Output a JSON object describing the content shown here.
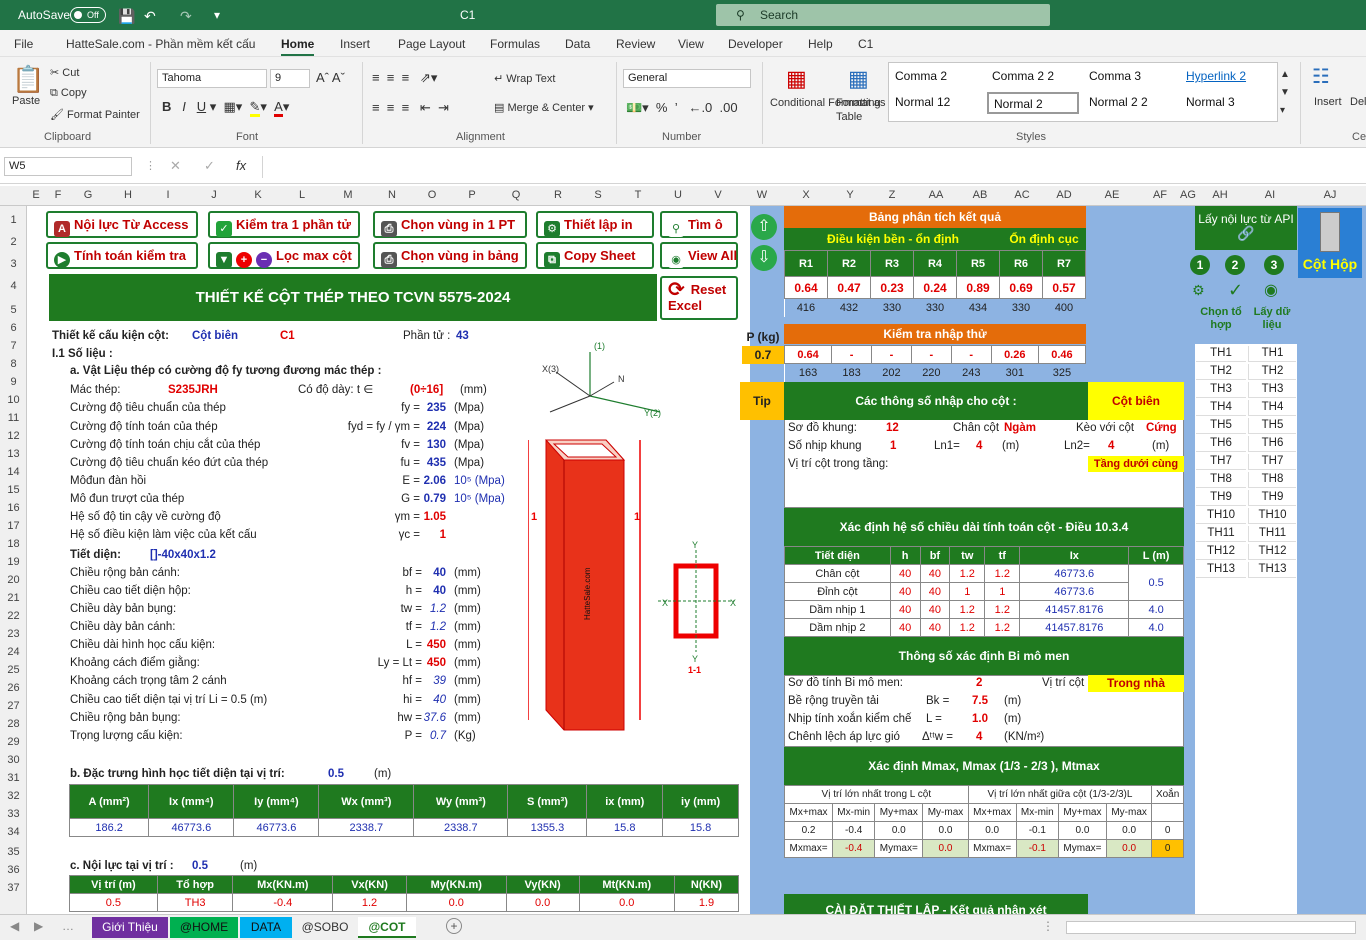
{
  "titlebar": {
    "autosave": "AutoSave",
    "autosave_state": "Off",
    "doc": "C1",
    "search": "Search"
  },
  "menu": [
    "File",
    "HatteSale.com - Phần mềm kết cấu",
    "Home",
    "Insert",
    "Page Layout",
    "Formulas",
    "Data",
    "Review",
    "View",
    "Developer",
    "Help",
    "C1"
  ],
  "ribbon": {
    "clipboard": {
      "paste": "Paste",
      "cut": "Cut",
      "copy": "Copy",
      "format_painter": "Format Painter",
      "group": "Clipboard"
    },
    "font": {
      "name": "Tahoma",
      "size": "9",
      "group": "Font"
    },
    "alignment": {
      "wrap": "Wrap Text",
      "merge": "Merge & Center",
      "group": "Alignment"
    },
    "number": {
      "format": "General",
      "group": "Number"
    },
    "styles": {
      "conditional": "Conditional Formatting",
      "format_table": "Format as Table",
      "items": [
        "Comma 2",
        "Comma 2 2",
        "Comma 3",
        "Hyperlink 2",
        "Normal 12",
        "Normal 2",
        "Normal 2 2",
        "Normal 3"
      ],
      "group": "Styles"
    },
    "cells": {
      "insert": "Insert",
      "delete": "Del",
      "group": "Ce"
    }
  },
  "formulabar": {
    "namebox": "W5",
    "fx": "fx"
  },
  "columns": [
    "E",
    "F",
    "G",
    "H",
    "I",
    "J",
    "K",
    "L",
    "M",
    "N",
    "O",
    "P",
    "Q",
    "R",
    "S",
    "T",
    "U",
    "V",
    "W",
    "X",
    "Y",
    "Z",
    "AA",
    "AB",
    "AC",
    "AD",
    "AE",
    "AF",
    "AG",
    "AH",
    "AI",
    "AJ"
  ],
  "rows": [
    "1",
    "2",
    "3",
    "4",
    "5",
    "6",
    "7",
    "8",
    "9",
    "10",
    "11",
    "12",
    "13",
    "14",
    "15",
    "16",
    "17",
    "18",
    "19",
    "20",
    "21",
    "22",
    "23",
    "24",
    "25",
    "26",
    "27",
    "28",
    "29",
    "30",
    "31",
    "32",
    "33",
    "34",
    "35",
    "36",
    "37"
  ],
  "buttons": {
    "noiluc": "Nội lực Từ Access",
    "kiemtra1": "Kiểm tra 1 phần tử",
    "chonvung1pt": "Chọn vùng in 1 PT",
    "thietlapin": "Thiết lập in",
    "timo": "Tìm ô",
    "tinhtoan": "Tính toán kiểm tra",
    "locmax": "Lọc max cột",
    "chonvungbang": "Chọn vùng in bảng",
    "copysheet": "Copy Sheet",
    "viewall": "View All",
    "reset": "Reset Excel"
  },
  "main": {
    "title": "THIẾT KẾ CỘT THÉP THEO TCVN 5575-2024",
    "design_label": "Thiết kế cấu kiện cột:",
    "design_val": "Cột biên",
    "design_id": "C1",
    "element_label": "Phần tử :",
    "element_no": "43",
    "s11": "I.1  Số liệu :",
    "s_a": "a. Vật Liệu thép có cường độ fy tương đương mác thép :",
    "props": [
      {
        "lbl": "Mác thép:",
        "sym": "",
        "val": "S235JRH",
        "unit": ""
      },
      {
        "lbl": "Cường độ tiêu chuẩn của thép",
        "sym": "fy =",
        "val": "235",
        "unit": "(Mpa)"
      },
      {
        "lbl": "Cường độ tính toán của thép",
        "sym": "fyd = fy / γm =",
        "val": "224",
        "unit": "(Mpa)"
      },
      {
        "lbl": "Cường độ tính toán chịu cắt của thép",
        "sym": "fv =",
        "val": "130",
        "unit": "(Mpa)"
      },
      {
        "lbl": "Cường độ tiêu chuẩn kéo đứt của thép",
        "sym": "fu =",
        "val": "435",
        "unit": "(Mpa)"
      },
      {
        "lbl": "Môđun đàn hồi",
        "sym": "E =",
        "val": "2.06",
        "unit": "10⁵ (Mpa)"
      },
      {
        "lbl": "Mô đun trượt của thép",
        "sym": "G =",
        "val": "0.79",
        "unit": "10⁵ (Mpa)"
      },
      {
        "lbl": "Hệ số độ tin cậy về cường độ",
        "sym": "γm =",
        "val": "1.05",
        "unit": ""
      },
      {
        "lbl": "Hệ số điều kiện làm việc của kết cấu",
        "sym": "γc =",
        "val": "1",
        "unit": ""
      }
    ],
    "thickness_label": "Có độ dày: t ∈",
    "thickness_val": "(0÷16]",
    "thickness_unit": "(mm)",
    "section_label": "Tiết diện:",
    "section_val": "[]-40x40x1.2",
    "dims": [
      {
        "lbl": "Chiều rộng bản cánh:",
        "sym": "bf =",
        "val": "40",
        "unit": "(mm)"
      },
      {
        "lbl": "Chiều cao tiết diện hộp:",
        "sym": "h =",
        "val": "40",
        "unit": "(mm)"
      },
      {
        "lbl": "Chiều dày bản bụng:",
        "sym": "tw =",
        "val": "1.2",
        "unit": "(mm)"
      },
      {
        "lbl": "Chiều dày bản cánh:",
        "sym": "tf =",
        "val": "1.2",
        "unit": "(mm)"
      },
      {
        "lbl": "Chiều dài hình học cấu kiện:",
        "sym": "L =",
        "val": "450",
        "unit": "(mm)"
      },
      {
        "lbl": "Khoảng cách điểm giằng:",
        "sym": "Ly = Lt =",
        "val": "450",
        "unit": "(mm)"
      },
      {
        "lbl": "Khoảng cách trọng tâm 2 cánh",
        "sym": "hf =",
        "val": "39",
        "unit": "(mm)"
      },
      {
        "lbl": "Chiều cao tiết diện tại vị trí Li =     0.5    (m)",
        "sym": "hi =",
        "val": "40",
        "unit": "(mm)"
      },
      {
        "lbl": "Chiều rộng bản bụng:",
        "sym": "hw =",
        "val": "37.6",
        "unit": "(mm)"
      },
      {
        "lbl": "Trọng lượng cấu kiện:",
        "sym": "P =",
        "val": "0.7",
        "unit": "(Kg)"
      }
    ],
    "s_b": "b. Đặc trưng hình học tiết diện tại vị trí:",
    "s_b_val": "0.5",
    "s_b_unit": "(m)",
    "geo_headers": [
      "A (mm²)",
      "Ix (mm⁴)",
      "Iy (mm⁴)",
      "Wx (mm³)",
      "Wy (mm³)",
      "S (mm³)",
      "ix (mm)",
      "iy (mm)"
    ],
    "geo_values": [
      "186.2",
      "46773.6",
      "46773.6",
      "2338.7",
      "2338.7",
      "1355.3",
      "15.8",
      "15.8"
    ],
    "s_c": "c. Nội lực tại vị trí :",
    "s_c_val": "0.5",
    "s_c_unit": "(m)",
    "force_headers": [
      "Vị trí (m)",
      "Tổ hợp",
      "Mx(KN.m)",
      "Vx(KN)",
      "My(KN.m)",
      "Vy(KN)",
      "Mt(KN.m)",
      "N(KN)"
    ],
    "force_values": [
      "0.5",
      "TH3",
      "-0.4",
      "1.2",
      "0.0",
      "0.0",
      "0.0",
      "1.9"
    ],
    "section_caption": "1-1",
    "watermark": "HatteSale.com"
  },
  "right": {
    "results_title": "Bảng phân tích kết quả",
    "dk_ben": "Điều kiện bền - ổn định",
    "on_dinh": "Ổn định cục bộ",
    "r_headers": [
      "R1",
      "R2",
      "R3",
      "R4",
      "R5",
      "R6",
      "R7"
    ],
    "r_values": [
      "0.64",
      "0.47",
      "0.23",
      "0.24",
      "0.89",
      "0.69",
      "0.57"
    ],
    "row5": [
      "416",
      "432",
      "330",
      "330",
      "434",
      "330",
      "400"
    ],
    "p_label": "P (kg)",
    "p_val": "0.7",
    "kiemtra": "Kiểm tra nhập thử",
    "row7": [
      "0.64",
      "-",
      "-",
      "-",
      "-",
      "0.26",
      "0.46"
    ],
    "row8": [
      "163",
      "183",
      "202",
      "220",
      "243",
      "301",
      "325"
    ],
    "tip": "Tip",
    "input_title": "Các thông số nhập cho cột :",
    "input_val": "Cột biên",
    "sodokhung_l": "Sơ đồ khung:",
    "sodokhung_v": "12",
    "chancot_l": "Chân cột",
    "chancot_v": "Ngàm",
    "keo_l": "Kèo với cột",
    "keo_v": "Cứng",
    "sonhip_l": "Số nhịp khung",
    "sonhip_v": "1",
    "ln1_l": "Ln1=",
    "ln1_v": "4",
    "ln1_u": "(m)",
    "ln2_l": "Ln2=",
    "ln2_v": "4",
    "ln2_u": "(m)",
    "vitri_l": "Vị trí cột trong tầng:",
    "vitri_v": "Tầng dưới cùng",
    "hs_title": "Xác định hệ số chiều dài tính toán cột - Điều 10.3.4",
    "hs_headers": [
      "Tiết diện",
      "h",
      "bf",
      "tw",
      "tf",
      "Ix",
      "L (m)"
    ],
    "hs_rows": [
      [
        "Chân cột",
        "40",
        "40",
        "1.2",
        "1.2",
        "46773.6",
        "0.5"
      ],
      [
        "Đỉnh cột",
        "40",
        "40",
        "1",
        "1",
        "46773.6",
        ""
      ],
      [
        "Dầm nhịp 1",
        "40",
        "40",
        "1.2",
        "1.2",
        "41457.8176",
        "4.0"
      ],
      [
        "Dầm nhịp 2",
        "40",
        "40",
        "1.2",
        "1.2",
        "41457.8176",
        "4.0"
      ]
    ],
    "bi_title": "Thông số xác định Bi mô men",
    "bi_sodo_l": "Sơ đồ tính Bi mô men:",
    "bi_sodo_v": "2",
    "bi_vitri_l": "Vị trí cột",
    "bi_vitri_v": "Trong nhà",
    "bk_l": "Bề rộng truyền tải",
    "bk_s": "Bk =",
    "bk_v": "7.5",
    "bk_u": "(m)",
    "l_l": "Nhịp tính xoắn kiểm chế",
    "l_s": "L =",
    "l_v": "1.0",
    "l_u": "(m)",
    "w_l": "Chênh lệch áp lực gió",
    "w_s": "Δᵗᵗw =",
    "w_v": "4",
    "w_u": "(KN/m²)",
    "mmax_title": "Xác định Mmax, Mmax (1/3 - 2/3 ), Mtmax",
    "mmax_h1": "Vị trí lớn nhất trong L cột",
    "mmax_h2": "Vị trí lớn nhất giữa cột (1/3-2/3)L",
    "mmax_h3": "Xoắn",
    "mmax_sub": [
      "Mx+max",
      "Mx-min",
      "My+max",
      "My-max",
      "Mx+max",
      "Mx-min",
      "My+max",
      "My-max"
    ],
    "mmax_vals": [
      "0.2",
      "-0.4",
      "0.0",
      "0.0",
      "0.0",
      "-0.1",
      "0.0",
      "0.0",
      "0"
    ],
    "mmax_row": [
      "Mxmax=",
      "-0.4",
      "Mymax=",
      "0.0",
      "Mxmax=",
      "-0.1",
      "Mymax=",
      "0.0",
      "0"
    ],
    "setup": "CÀI ĐẶT THIẾT LẬP - Kết quả nhận xét",
    "api_btn": "Lấy nội lực từ API",
    "cothop": "Cột Hộp",
    "steps": [
      "1",
      "2",
      "3"
    ],
    "chon_th": "Chọn tổ hợp",
    "lay_du": "Lấy dữ liệu",
    "th_list": [
      "TH1",
      "TH2",
      "TH3",
      "TH4",
      "TH5",
      "TH6",
      "TH7",
      "TH8",
      "TH9",
      "TH10",
      "TH11",
      "TH12",
      "TH13"
    ]
  },
  "tabs": [
    "Giới Thiệu",
    "@HOME",
    "DATA",
    "@SOBO",
    "@COT"
  ],
  "colors": {
    "excel_green": "#217346",
    "sheet_green": "#1f7a1f",
    "orange": "#e46c0a",
    "yellow": "#ffff00",
    "api_bg": "#8db3e2"
  }
}
